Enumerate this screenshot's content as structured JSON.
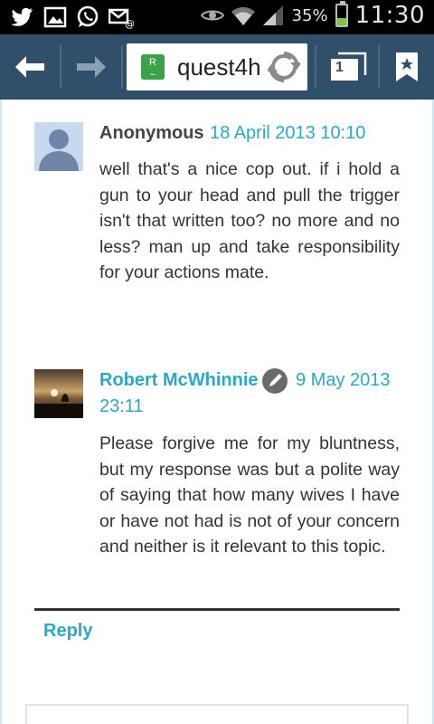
{
  "status_bar": {
    "battery_percent": "35%",
    "battery_level": 0.35,
    "time": "11:30",
    "icons": [
      "twitter-icon",
      "gallery-icon",
      "whatsapp-icon",
      "email-icon",
      "eye-icon",
      "wifi-icon",
      "signal-icon",
      "battery-icon"
    ]
  },
  "toolbar": {
    "url_text": "quest4h",
    "tab_count": "1",
    "colors": {
      "bar": "#2f4f6b",
      "favicon": "#3aa24a"
    }
  },
  "comments": [
    {
      "author": "Anonymous",
      "date_line_1": "18 April 2013 10:10",
      "body": "well that's a nice cop out. if i hold a gun to your head and pull the trigger isn't that written too? no more and no less? man up and take responsibility for your actions mate."
    },
    {
      "author": "Robert McWhinnie",
      "date_line_1": "9 May 2013",
      "date_line_2": "23:11",
      "body": "Please forgive me for my bluntness, but my response was but a polite way of saying that how many wives I have or have not had is not of your concern and neither is it relevant to this topic."
    }
  ],
  "reply_label": "Reply",
  "colors": {
    "link": "#2aa8c9",
    "text": "#333333"
  }
}
